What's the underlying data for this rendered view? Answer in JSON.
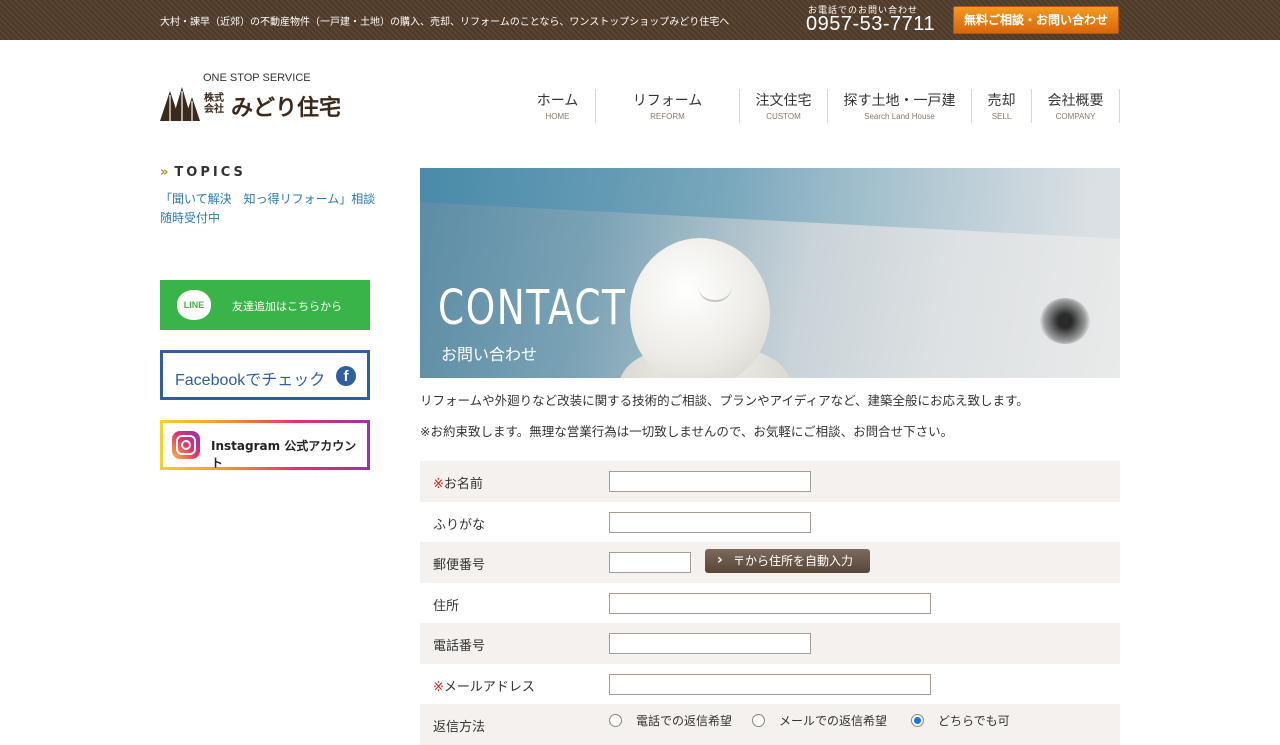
{
  "topbar": {
    "tagline": "大村・諫早（近郊）の不動産物件（一戸建・土地）の購入、売却、リフォームのことなら、ワンストップショップみどり住宅へ",
    "tel_caption": "お電話でのお問い合わせ",
    "tel": "0957-53-7711",
    "cta_label": "無料ご相談・お問い合わせ"
  },
  "logo": {
    "subtitle": "ONE STOP SERVICE",
    "company_type": "株式会社",
    "name": "みどり住宅"
  },
  "nav": [
    {
      "jp": "ホーム",
      "en": "HOME"
    },
    {
      "jp": "リフォーム",
      "en": "REFORM"
    },
    {
      "jp": "注文住宅",
      "en": "CUSTOM"
    },
    {
      "jp": "探す土地・一戸建",
      "en": "Search Land House"
    },
    {
      "jp": "売却",
      "en": "SELL"
    },
    {
      "jp": "会社概要",
      "en": "COMPANY"
    }
  ],
  "sidebar": {
    "topics_title": "TOPICS",
    "topics_link": "「聞いて解決　知っ得リフォーム」相談随時受付中",
    "line_icon": "LINE",
    "line_label": "友達追加はこちらから",
    "facebook_label": "Facebookでチェック",
    "facebook_icon": "f",
    "instagram_label": "Instagram 公式アカウント"
  },
  "hero": {
    "title_en": "CONTACT",
    "title_jp": "お問い合わせ"
  },
  "intro": {
    "line1": "リフォームや外廻りなど改装に関する技術的ご相談、プランやアイディアなど、建築全般にお応え致します。",
    "line2": "※お約束致します。無理な営業行為は一切致しませんので、お気軽にご相談、お問合せ下さい。"
  },
  "form": {
    "required_mark": "※",
    "name_label": "お名前",
    "furigana_label": "ふりがな",
    "zip_label": "郵便番号",
    "zip_button": "〒から住所を自動入力",
    "address_label": "住所",
    "phone_label": "電話番号",
    "email_label": "メールアドレス",
    "reply_label": "返信方法",
    "reply_options": [
      "電話での返信希望",
      "メールでの返信希望",
      "どちらでも可"
    ],
    "reply_selected": "どちらでも可"
  }
}
